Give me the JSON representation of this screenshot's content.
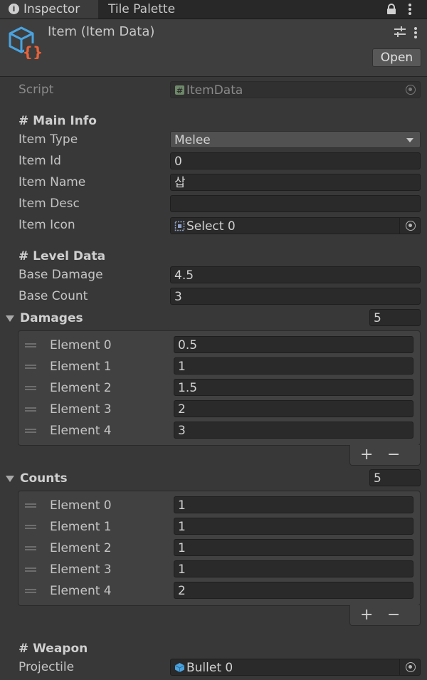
{
  "tabs": {
    "inspector": "Inspector",
    "tile_palette": "Tile Palette"
  },
  "header": {
    "title": "Item (Item Data)",
    "open_label": "Open"
  },
  "script_row": {
    "label": "Script",
    "value": "ItemData"
  },
  "main_info": {
    "heading": "# Main Info",
    "item_type": {
      "label": "Item Type",
      "value": "Melee"
    },
    "item_id": {
      "label": "Item Id",
      "value": "0"
    },
    "item_name": {
      "label": "Item Name",
      "value": "삽"
    },
    "item_desc": {
      "label": "Item Desc",
      "value": ""
    },
    "item_icon": {
      "label": "Item Icon",
      "value": "Select 0"
    }
  },
  "level_data": {
    "heading": "# Level Data",
    "base_damage": {
      "label": "Base Damage",
      "value": "4.5"
    },
    "base_count": {
      "label": "Base Count",
      "value": "3"
    }
  },
  "damages": {
    "label": "Damages",
    "size": "5",
    "elements": [
      {
        "label": "Element 0",
        "value": "0.5"
      },
      {
        "label": "Element 1",
        "value": "1"
      },
      {
        "label": "Element 2",
        "value": "1.5"
      },
      {
        "label": "Element 3",
        "value": "2"
      },
      {
        "label": "Element 4",
        "value": "3"
      }
    ]
  },
  "counts": {
    "label": "Counts",
    "size": "5",
    "elements": [
      {
        "label": "Element 0",
        "value": "1"
      },
      {
        "label": "Element 1",
        "value": "1"
      },
      {
        "label": "Element 2",
        "value": "1"
      },
      {
        "label": "Element 3",
        "value": "1"
      },
      {
        "label": "Element 4",
        "value": "2"
      }
    ]
  },
  "weapon": {
    "heading": "# Weapon",
    "projectile": {
      "label": "Projectile",
      "value": "Bullet 0"
    }
  },
  "list_buttons": {
    "add": "+",
    "remove": "−"
  },
  "colors": {
    "background": "#383838",
    "field": "#2a2a2a",
    "accent_orange": "#e8623a",
    "accent_blue": "#4aa3df"
  }
}
